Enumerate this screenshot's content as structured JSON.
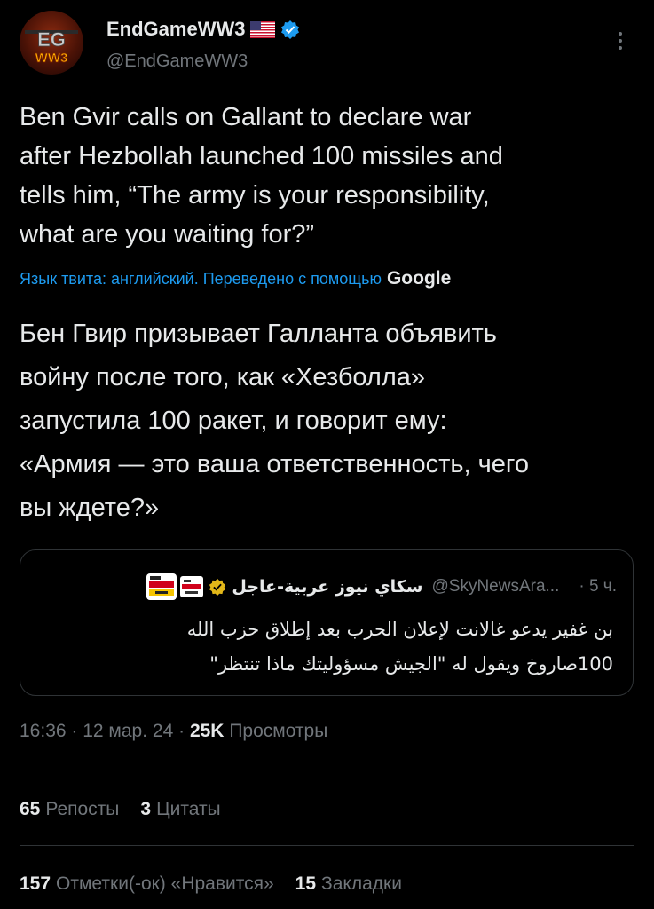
{
  "author": {
    "display_name": "EndGameWW3",
    "handle": "@EndGameWW3",
    "avatar_text": "EG WW3",
    "flag": "us-flag-icon",
    "verified": "verified-badge-icon"
  },
  "tweet": {
    "text": "Ben Gvir calls on Gallant to declare war\nafter Hezbollah launched 100 missiles and\ntells him, “The army is your responsibility,\nwhat are you waiting for?”",
    "translation_note": "Язык твита: английский. Переведено с помощью",
    "translation_provider": "Google",
    "translated_text": "Бен Гвир призывает Галланта объявить\nвойну после того, как «Хезболла»\nзапустила 100 ракет, и говорит ему:\n«Армия — это ваша ответственность, чего\nвы ждете?»"
  },
  "quote": {
    "name": "سكاي نيوز عربية-عاجل",
    "handle": "@SkyNewsAra...",
    "time": "· 5 ч.",
    "text": "بن غفير يدعو غالانت لإعلان الحرب بعد إطلاق حزب الله\n100صاروخ ويقول له \"الجيش مسؤوليتك ماذا تنتظر\"",
    "logo_text": "sky news عربية",
    "colors": {
      "logo_bg": "#ffffff",
      "logo_accent": "#d0021b",
      "logo_yellow": "#f5c400"
    }
  },
  "meta": {
    "time": "16:36",
    "date": "12 мар. 24",
    "views_count": "25K",
    "views_label": "Просмотры"
  },
  "stats": {
    "reposts_count": "65",
    "reposts_label": "Репосты",
    "quotes_count": "3",
    "quotes_label": "Цитаты",
    "likes_count": "157",
    "likes_label": "Отметки(-ок) «Нравится»",
    "bookmarks_count": "15",
    "bookmarks_label": "Закладки"
  },
  "colors": {
    "background": "#000000",
    "text": "#e7e9ea",
    "secondary": "#71767b",
    "accent": "#1d9bf0",
    "divider": "#2f3336"
  }
}
